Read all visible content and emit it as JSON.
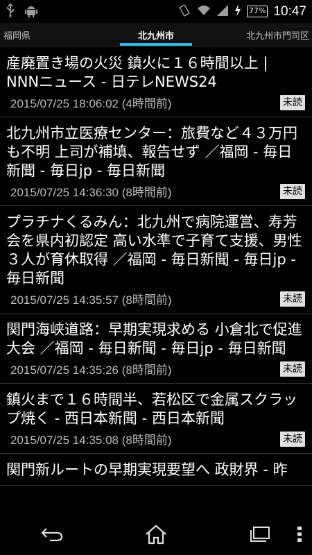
{
  "status_bar": {
    "left_icons": [
      "usb-icon",
      "android-icon"
    ],
    "right_icons": [
      "vibrate-icon",
      "wifi-icon",
      "signal-icon",
      "charging-icon"
    ],
    "battery": "77%",
    "time": "10:47"
  },
  "tabs": {
    "left": "福岡県",
    "center": "北九州市",
    "right": "北九州市門司区",
    "accent": "#33b5e5"
  },
  "news": [
    {
      "title": "産廃置き場の火災 鎮火に１６時間以上 | NNNニュース - 日テレNEWS24",
      "date": "2015/07/25 18:06:02 (4時間前)",
      "badge": "未読"
    },
    {
      "title": "北九州市立医療センター：旅費など４３万円も不明 上司が補填、報告せず ／福岡 - 毎日新聞 - 毎日jp - 毎日新聞",
      "date": "2015/07/25 14:36:30 (8時間前)",
      "badge": "未読"
    },
    {
      "title": "プラチナくるみん：北九州で病院運営、寿芳会を県内初認定 高い水準で子育て支援、男性３人が育休取得 ／福岡 - 毎日新聞 - 毎日jp - 毎日新聞",
      "date": "2015/07/25 14:35:57 (8時間前)",
      "badge": "未読"
    },
    {
      "title": "関門海峡道路：早期実現求める 小倉北で促進大会 ／福岡 - 毎日新聞 - 毎日jp - 毎日新聞",
      "date": "2015/07/25 14:35:26 (8時間前)",
      "badge": "未読"
    },
    {
      "title": "鎮火まで１６時間半、若松区で金属スクラップ焼く - 西日本新聞 - 西日本新聞",
      "date": "2015/07/25 14:35:08 (8時間前)",
      "badge": "未読"
    },
    {
      "title": "関門新ルートの早期実現要望へ 政財界 - 昨",
      "date": "",
      "badge": ""
    }
  ],
  "nav": {
    "icons": [
      "back-icon",
      "home-icon",
      "recent-apps-icon",
      "overflow-menu-icon"
    ]
  }
}
